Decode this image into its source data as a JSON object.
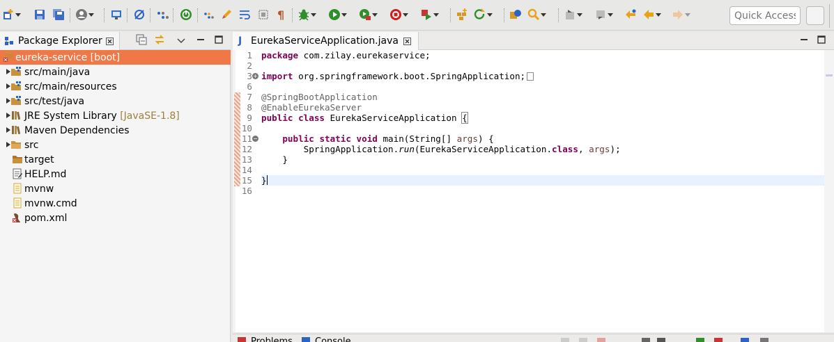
{
  "toolbar": {
    "quick_access_placeholder": "Quick Access",
    "icons": [
      "new-icon",
      "save-icon",
      "save-all-icon",
      "profile-icon",
      "monitor-icon",
      "skip-breakpoints-icon",
      "toggle-icon",
      "spring-boot-icon",
      "pencil-icon",
      "word-wrap-icon",
      "block-select-icon",
      "pilcrow-icon",
      "debug-icon",
      "run-icon",
      "coverage-icon",
      "stop-icon",
      "run-external-icon",
      "new-package-icon",
      "refresh-icon",
      "open-type-icon",
      "search-icon",
      "annotation-next-icon",
      "annotation-prev-icon",
      "last-edit-icon",
      "back-icon",
      "forward-icon"
    ]
  },
  "package_explorer": {
    "title": "Package Explorer",
    "tree": [
      {
        "label": "eureka-service",
        "decoration": " [boot]",
        "icon": "project-icon",
        "selected": true
      },
      {
        "label": "src/main/java",
        "decoration": "",
        "icon": "source-folder-icon",
        "selected": false
      },
      {
        "label": "src/main/resources",
        "decoration": "",
        "icon": "source-folder-icon",
        "selected": false
      },
      {
        "label": "src/test/java",
        "decoration": "",
        "icon": "source-folder-icon",
        "selected": false
      },
      {
        "label": "JRE System Library",
        "decoration": " [JavaSE-1.8]",
        "icon": "library-icon",
        "selected": false
      },
      {
        "label": "Maven Dependencies",
        "decoration": "",
        "icon": "library-icon",
        "selected": false
      },
      {
        "label": "src",
        "decoration": "",
        "icon": "folder-icon",
        "selected": false
      },
      {
        "label": "target",
        "decoration": "",
        "icon": "folder-icon",
        "selected": false
      },
      {
        "label": "HELP.md",
        "decoration": "",
        "icon": "markdown-file-icon",
        "selected": false
      },
      {
        "label": "mvnw",
        "decoration": "",
        "icon": "text-file-icon",
        "selected": false
      },
      {
        "label": "mvnw.cmd",
        "decoration": "",
        "icon": "text-file-icon",
        "selected": false
      },
      {
        "label": "pom.xml",
        "decoration": "",
        "icon": "xml-file-icon",
        "selected": false
      }
    ]
  },
  "editor": {
    "tab_title": "EurekaServiceApplication.java",
    "line_numbers": [
      "1",
      "2",
      "3",
      "6",
      "7",
      "8",
      "9",
      "10",
      "11",
      "12",
      "13",
      "14",
      "15",
      "16"
    ],
    "code": {
      "l1_kw": "package",
      "l1_rest": " com.zilay.eurekaservice;",
      "l3_kw": "import",
      "l3_rest": " org.springframework.boot.SpringApplication;",
      "l7": "@SpringBootApplication",
      "l8": "@EnableEurekaServer",
      "l9_kw1": "public",
      "l9_kw2": "class",
      "l9_name": " EurekaServiceApplication ",
      "l9_brace": "{",
      "l11_kw1": "public",
      "l11_kw2": "static",
      "l11_kw3": "void",
      "l11_rest": " main(String[] ",
      "l11_param": "args",
      "l11_end": ") {",
      "l12_pre": "SpringApplication.",
      "l12_method": "run",
      "l12_mid": "(EurekaServiceApplication.",
      "l12_kw": "class",
      "l12_sep": ", ",
      "l12_param": "args",
      "l12_end": ");",
      "l13": "}",
      "l15": "}"
    }
  },
  "bottom": {
    "tabs": [
      "Problems",
      "Console"
    ]
  },
  "colors": {
    "keyword": "#7f0055",
    "annotation": "#646464",
    "selection": "#f07746",
    "current_line": "#e8f2fe"
  }
}
